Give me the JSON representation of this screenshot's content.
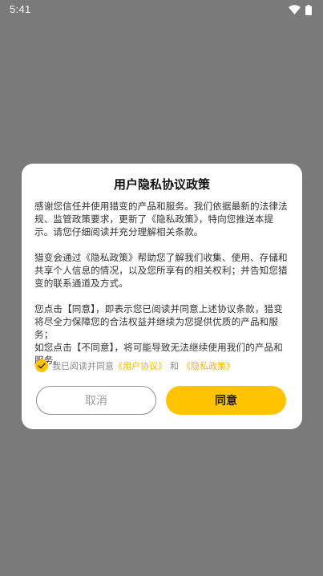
{
  "status_bar": {
    "time": "5:41",
    "icons": [
      "wifi-icon",
      "battery-icon"
    ]
  },
  "dialog": {
    "title": "用户隐私协议政策",
    "paragraphs": [
      "感谢您信任并使用猎变的产品和服务。我们依据最新的法律法规、监管政策要求，更新了《隐私政策》，特向您推送本提示。请您仔细阅读并充分理解相关条款。",
      "猎变会通过《隐私政策》帮助您了解我们收集、使用、存储和共享个人信息的情况，以及您所享有的相关权利；并告知您猎变的联系通道及方式。",
      "您点击【同意】，即表示您已阅读并同意上述协议条款，猎变将尽全力保障您的合法权益并继续为您提供优质的产品和服务；",
      "如您点击【不同意】，将可能导致无法继续使用我们的产品和服务。"
    ],
    "agree_row": {
      "checked": true,
      "prefix": "我已阅读并同意",
      "user_agreement_link": "《用户协议》",
      "and": "和",
      "privacy_policy_link": "《隐私政策》"
    },
    "cancel_label": "取消",
    "agree_label": "同意"
  },
  "colors": {
    "accent": "#ffc300",
    "link": "#f5b400",
    "overlay": "#7a7a7a"
  }
}
